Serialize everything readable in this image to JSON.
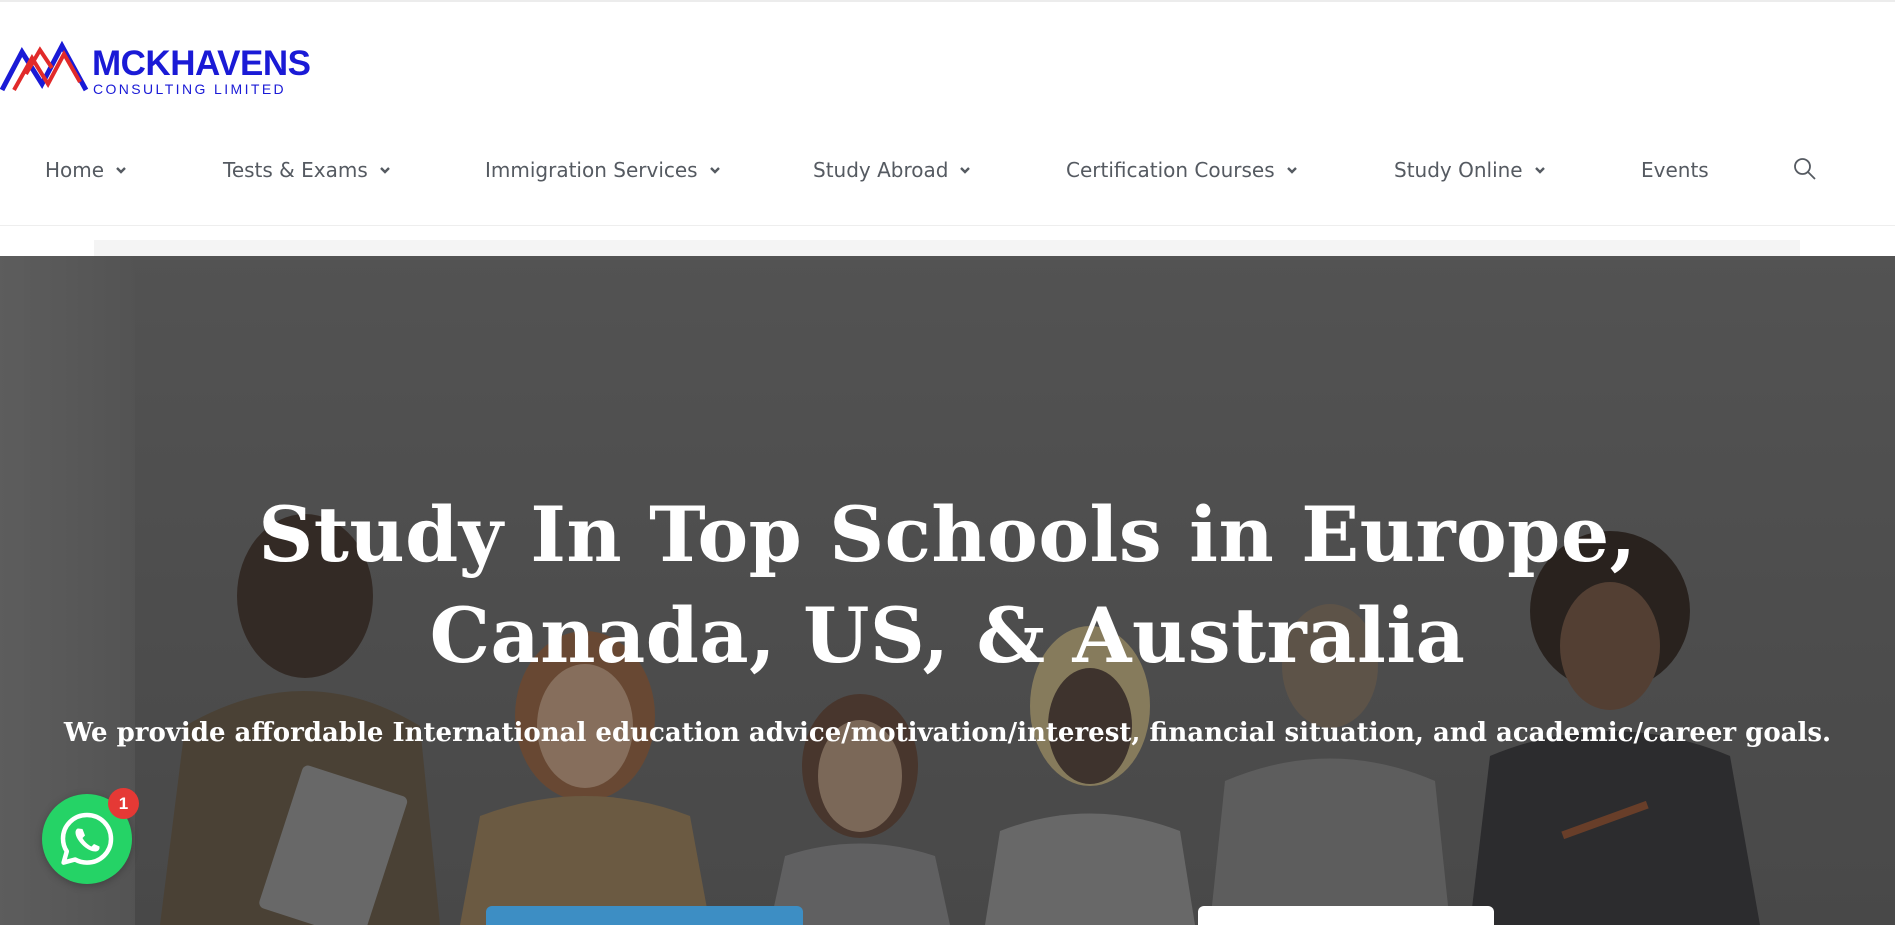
{
  "logo": {
    "name": "MCKHAVENS",
    "tagline": "CONSULTING LIMITED",
    "colors": {
      "blue": "#1a1ad6",
      "red": "#e12a2a"
    }
  },
  "nav": {
    "items": [
      {
        "label": "Home",
        "has_dropdown": true
      },
      {
        "label": "Tests & Exams",
        "has_dropdown": true
      },
      {
        "label": "Immigration Services",
        "has_dropdown": true
      },
      {
        "label": "Study Abroad",
        "has_dropdown": true
      },
      {
        "label": "Certification Courses",
        "has_dropdown": true
      },
      {
        "label": "Study Online",
        "has_dropdown": true
      },
      {
        "label": "Events",
        "has_dropdown": false
      }
    ],
    "search_icon": "search-icon",
    "text_color": "#555a61"
  },
  "hero": {
    "title_line1": "Study In Top Schools in Europe,",
    "title_line2": "Canada, US, & Australia",
    "subtitle": "We provide affordable International education advice/motivation/interest, financial situation, and academic/career goals.",
    "primary_button_color": "#3d8ec4",
    "secondary_button_color": "#ffffff"
  },
  "whatsapp": {
    "icon": "whatsapp-icon",
    "badge_count": "1",
    "color": "#25d366",
    "badge_color": "#e53935"
  }
}
